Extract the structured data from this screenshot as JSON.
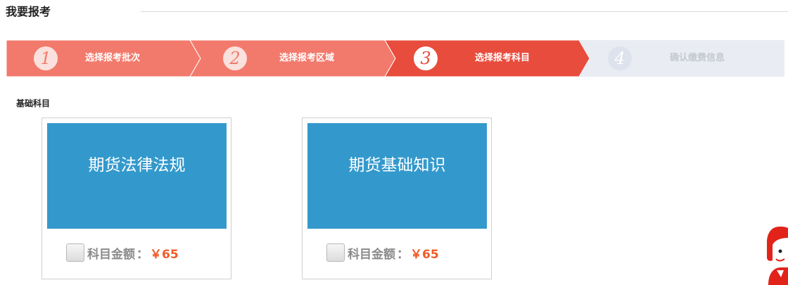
{
  "header": {
    "title": "我要报考"
  },
  "steps": [
    {
      "number": "1",
      "label": "选择报考批次",
      "state": "done"
    },
    {
      "number": "2",
      "label": "选择报考区域",
      "state": "done"
    },
    {
      "number": "3",
      "label": "选择报考科目",
      "state": "active"
    },
    {
      "number": "4",
      "label": "确认缴费信息",
      "state": "pending"
    }
  ],
  "section": {
    "title": "基础科目"
  },
  "subjects": [
    {
      "name": "期货法律法规",
      "fee_label": "科目金额",
      "fee_separator": "：",
      "price": "￥65",
      "checked": false
    },
    {
      "name": "期货基础知识",
      "fee_label": "科目金额",
      "fee_separator": "：",
      "price": "￥65",
      "checked": false
    }
  ],
  "colors": {
    "done": "#f27a6c",
    "active": "#e84c3d",
    "pending": "#e9ecf2",
    "tile": "#3399cc",
    "price": "#f05a28"
  },
  "icons": {
    "mascot": "customer-service-avatar-icon"
  }
}
